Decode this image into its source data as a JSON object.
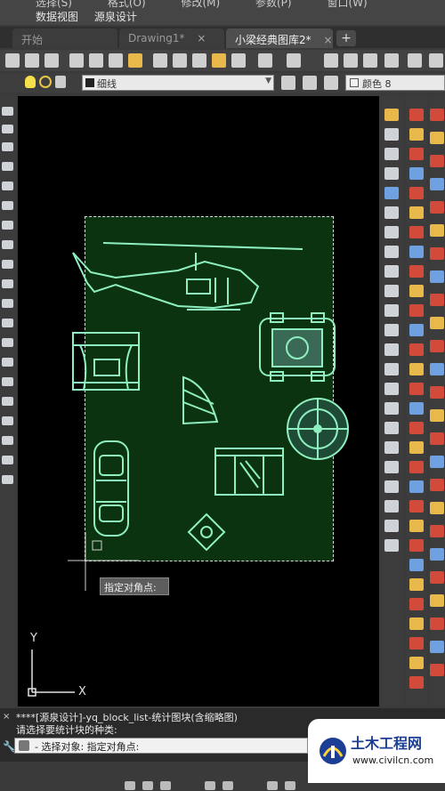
{
  "menubar": {
    "top_items": [
      "选择(S)",
      "格式(O)",
      "修改(M)",
      "参数(P)",
      "窗口(W)"
    ],
    "items": [
      "数据视图",
      "源泉设计"
    ]
  },
  "tabs": [
    {
      "label": "开始",
      "active": false
    },
    {
      "label": "Drawing1*",
      "active": false
    },
    {
      "label": "小梁经典图库2*",
      "active": true
    }
  ],
  "tab_add_label": "+",
  "tab_close_glyph": "×",
  "properties": {
    "layer_value": "细线",
    "color_value": "颜色 8"
  },
  "canvas": {
    "background": "#000000",
    "selection_fill": "#0c3310",
    "block_color": "#8ef0c0",
    "tooltip": "指定对角点:",
    "ucs_x_label": "X",
    "ucs_y_label": "Y"
  },
  "command": {
    "close_glyph": "×",
    "line1": "****[源泉设计]-yq_block_list-统计图块(含缩略图)",
    "line2": "请选择要统计块的种类:",
    "input_text": "- 选择对象: 指定对角点:",
    "settings_icon": "wrench-icon"
  },
  "watermark": {
    "title": "土木工程网",
    "url": "www.civilcn.com"
  }
}
